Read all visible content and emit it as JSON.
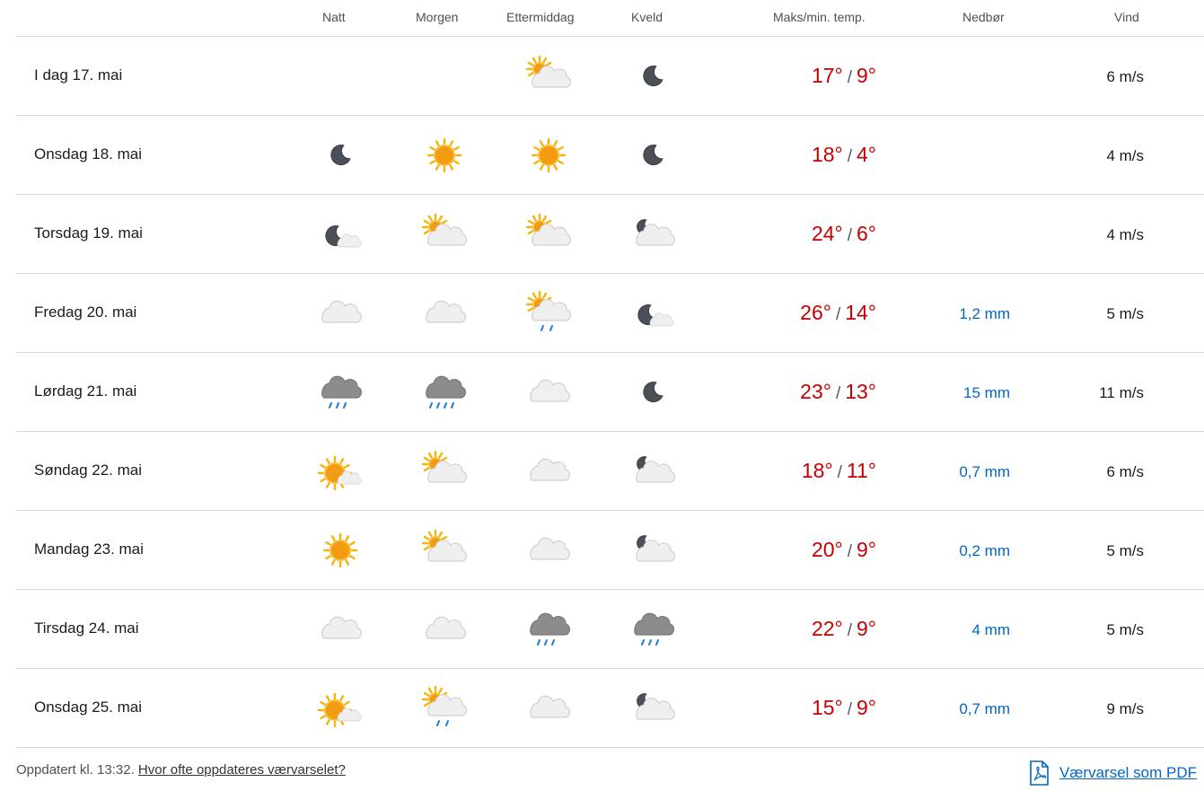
{
  "columns": {
    "night": "Natt",
    "morning": "Morgen",
    "afternoon": "Ettermiddag",
    "evening": "Kveld",
    "temp": "Maks/min. temp.",
    "precip": "Nedbør",
    "wind": "Vind"
  },
  "days": [
    {
      "label": "I dag 17. mai",
      "icons": [
        "",
        "",
        "partly-cloudy-day-icon",
        "moon-icon"
      ],
      "max": "17°",
      "min": "9°",
      "precip": "",
      "wind": "6 m/s"
    },
    {
      "label": "Onsdag 18. mai",
      "icons": [
        "moon-icon",
        "sun-icon",
        "sun-icon",
        "moon-icon"
      ],
      "max": "18°",
      "min": "4°",
      "precip": "",
      "wind": "4 m/s"
    },
    {
      "label": "Torsdag 19. mai",
      "icons": [
        "fair-night-icon",
        "partly-cloudy-day-icon",
        "partly-cloudy-day-icon",
        "partly-cloudy-night-icon"
      ],
      "max": "24°",
      "min": "6°",
      "precip": "",
      "wind": "4 m/s"
    },
    {
      "label": "Fredag 20. mai",
      "icons": [
        "cloud-icon",
        "cloud-icon",
        "rain-showers-day-icon",
        "fair-night-icon"
      ],
      "max": "26°",
      "min": "14°",
      "precip": "1,2 mm",
      "wind": "5 m/s"
    },
    {
      "label": "Lørdag 21. mai",
      "icons": [
        "rain-icon",
        "heavy-rain-icon",
        "cloud-icon",
        "moon-icon"
      ],
      "max": "23°",
      "min": "13°",
      "precip": "15 mm",
      "wind": "11 m/s"
    },
    {
      "label": "Søndag 22. mai",
      "icons": [
        "fair-day-icon",
        "partly-cloudy-day-icon",
        "cloud-icon",
        "partly-cloudy-night-icon"
      ],
      "max": "18°",
      "min": "11°",
      "precip": "0,7 mm",
      "wind": "6 m/s"
    },
    {
      "label": "Mandag 23. mai",
      "icons": [
        "sun-icon",
        "partly-cloudy-day-icon",
        "cloud-icon",
        "partly-cloudy-night-icon"
      ],
      "max": "20°",
      "min": "9°",
      "precip": "0,2 mm",
      "wind": "5 m/s"
    },
    {
      "label": "Tirsdag 24. mai",
      "icons": [
        "cloud-icon",
        "cloud-icon",
        "rain-icon",
        "rain-icon"
      ],
      "max": "22°",
      "min": "9°",
      "precip": "4 mm",
      "wind": "5 m/s"
    },
    {
      "label": "Onsdag 25. mai",
      "icons": [
        "fair-day-icon",
        "rain-showers-day-icon",
        "cloud-icon",
        "partly-cloudy-night-icon"
      ],
      "max": "15°",
      "min": "9°",
      "precip": "0,7 mm",
      "wind": "9 m/s"
    }
  ],
  "footer": {
    "updated": "Oppdatert kl. 13:32.",
    "link": "Hvor ofte oppdateres værvarselet?",
    "pdf_label": "Værvarsel som PDF"
  },
  "colors": {
    "temp_warm": "#c60000",
    "precip": "#0067c5",
    "link": "#0067c5"
  }
}
